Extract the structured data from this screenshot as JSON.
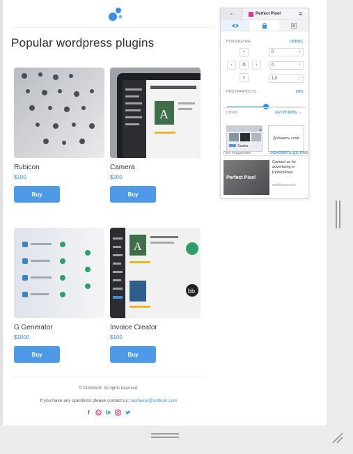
{
  "site": {
    "page_title": "Popular wordpress plugins",
    "products": [
      {
        "name": "Rubicon",
        "price": "$100",
        "buy": "Buy"
      },
      {
        "name": "Camera",
        "price": "$200",
        "buy": "Buy"
      },
      {
        "name": "G Generator",
        "price": "$1000",
        "buy": "Buy"
      },
      {
        "name": "Invoice Creator",
        "price": "$100",
        "buy": "Buy"
      }
    ],
    "footer": {
      "copyright": "© DUGMAR. All rights reserved.",
      "contact_prefix": "If you have any questions please contact us: ",
      "contact_email": "sashakul@outlook.com"
    },
    "social_icons": [
      "facebook-icon",
      "dribbble-icon",
      "linkedin-icon",
      "instagram-icon",
      "twitter-icon"
    ]
  },
  "perfect_pixel": {
    "minimize_label": "-",
    "brand": "Perfect Pixel",
    "menu_glyph": "≡",
    "tabs": [
      "visibility",
      "lock",
      "invert"
    ],
    "position_label": "ПОЛОЖЕНИЕ",
    "reset_label": "СБРОС",
    "arrows": {
      "up": "^",
      "left": "‹",
      "center": "Ф",
      "right": "›",
      "down": "v"
    },
    "x_value": "0",
    "x_unit": "X",
    "y_value": "0",
    "y_unit": "Y",
    "scale_value": "1.0",
    "scale_unit": "⤢",
    "opacity_label": "ПРОЗРАЧНОСТЬ",
    "opacity_value": "50%",
    "opacity_fraction": 0.5,
    "layers_label": "СЛОИ",
    "upload_label": "ЗАГРУЗИТЬ ⌄",
    "layer_name": "Sasha",
    "add_layer_label": "Добавить слой",
    "support_label": "При поддержке",
    "upgrade_label": "ОБНОВИТЬ ДО PRO",
    "ad_logo_text": "Perfect Pixel",
    "ad_text": "Contact us for advertising in PerfectPixel",
    "ad_sub": "welldonecode"
  },
  "colors": {
    "accent": "#4f9ae6",
    "link": "#3b8fe3",
    "brand": "#e2348f"
  }
}
